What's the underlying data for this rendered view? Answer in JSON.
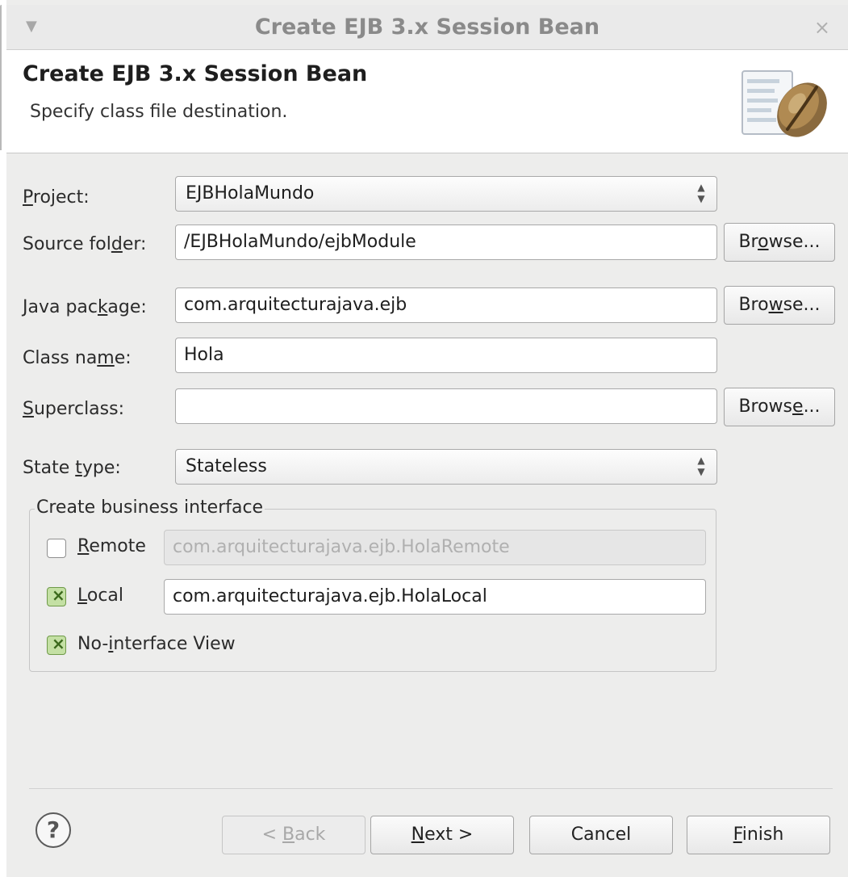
{
  "window": {
    "title": "Create EJB 3.x Session Bean",
    "menu_icon": "chevron-down-icon",
    "close_icon": "close-icon"
  },
  "banner": {
    "title": "Create EJB 3.x Session Bean",
    "subtitle": "Specify class file destination.",
    "icon": "coffee-bean-icon"
  },
  "form": {
    "project_label": {
      "pre": "",
      "u": "P",
      "post": "roject:"
    },
    "project_value": "EJBHolaMundo",
    "source_folder_label": {
      "pre": "Source fol",
      "u": "d",
      "post": "er:"
    },
    "source_folder_value": "/EJBHolaMundo/ejbModule",
    "java_package_label": {
      "pre": "Java pac",
      "u": "k",
      "post": "age:"
    },
    "java_package_value": "com.arquitecturajava.ejb",
    "class_name_label": {
      "pre": "Class na",
      "u": "m",
      "post": "e:"
    },
    "class_name_value": "Hola",
    "superclass_label": {
      "pre": "",
      "u": "S",
      "post": "uperclass:"
    },
    "superclass_value": "",
    "state_type_label": {
      "pre": "State ",
      "u": "t",
      "post": "ype:"
    },
    "state_type_value": "Stateless",
    "browse1": {
      "pre": "Br",
      "u": "o",
      "post": "wse..."
    },
    "browse2": {
      "pre": "Bro",
      "u": "w",
      "post": "se..."
    },
    "browse3": {
      "pre": "Brows",
      "u": "e",
      "post": "..."
    }
  },
  "business_interface": {
    "title": "Create business interface",
    "remote_label": {
      "pre": "",
      "u": "R",
      "post": "emote"
    },
    "remote_checked": false,
    "remote_value": "com.arquitecturajava.ejb.HolaRemote",
    "local_label": {
      "pre": "",
      "u": "L",
      "post": "ocal"
    },
    "local_checked": true,
    "local_value": "com.arquitecturajava.ejb.HolaLocal",
    "nointerface_label": {
      "pre": "No-",
      "u": "i",
      "post": "nterface View"
    },
    "nointerface_checked": true
  },
  "footer": {
    "help_icon": "help-icon",
    "help_glyph": "?",
    "back": {
      "pre": "< ",
      "u": "B",
      "post": "ack"
    },
    "next": {
      "pre": "",
      "u": "N",
      "post": "ext >"
    },
    "cancel": "Cancel",
    "finish": {
      "pre": "",
      "u": "F",
      "post": "inish"
    }
  }
}
